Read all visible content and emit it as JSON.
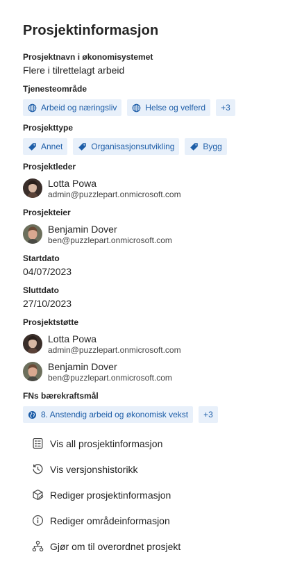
{
  "title": "Prosjektinformasjon",
  "fields": {
    "econ_label": "Prosjektnavn i økonomisystemet",
    "econ_value": "Flere i tilrettelagt arbeid",
    "service_label": "Tjenesteområde",
    "service_tags": [
      "Arbeid og næringsliv",
      "Helse og velferd"
    ],
    "service_more": "+3",
    "type_label": "Prosjekttype",
    "type_tags": [
      "Annet",
      "Organisasjonsutvikling",
      "Bygg"
    ],
    "leader_label": "Prosjektleder",
    "leader": {
      "name": "Lotta Powa",
      "email": "admin@puzzlepart.onmicrosoft.com"
    },
    "owner_label": "Prosjekteier",
    "owner": {
      "name": "Benjamin Dover",
      "email": "ben@puzzlepart.onmicrosoft.com"
    },
    "start_label": "Startdato",
    "start_value": "04/07/2023",
    "end_label": "Sluttdato",
    "end_value": "27/10/2023",
    "support_label": "Prosjektstøtte",
    "support": [
      {
        "name": "Lotta Powa",
        "email": "admin@puzzlepart.onmicrosoft.com"
      },
      {
        "name": "Benjamin Dover",
        "email": "ben@puzzlepart.onmicrosoft.com"
      }
    ],
    "sdg_label": "FNs bærekraftsmål",
    "sdg_tag": "8. Anstendig arbeid og økonomisk vekst",
    "sdg_more": "+3"
  },
  "actions": [
    {
      "label": "Vis all prosjektinformasjon",
      "icon": "form-list-icon"
    },
    {
      "label": "Vis versjonshistorikk",
      "icon": "history-icon"
    },
    {
      "label": "Rediger prosjektinformasjon",
      "icon": "box-edit-icon"
    },
    {
      "label": "Rediger områdeinformasjon",
      "icon": "info-icon"
    },
    {
      "label": "Gjør om til overordnet prosjekt",
      "icon": "org-chart-icon"
    }
  ],
  "colors": {
    "tag_bg": "#e8f0fa",
    "tag_text": "#1e5ea8"
  }
}
